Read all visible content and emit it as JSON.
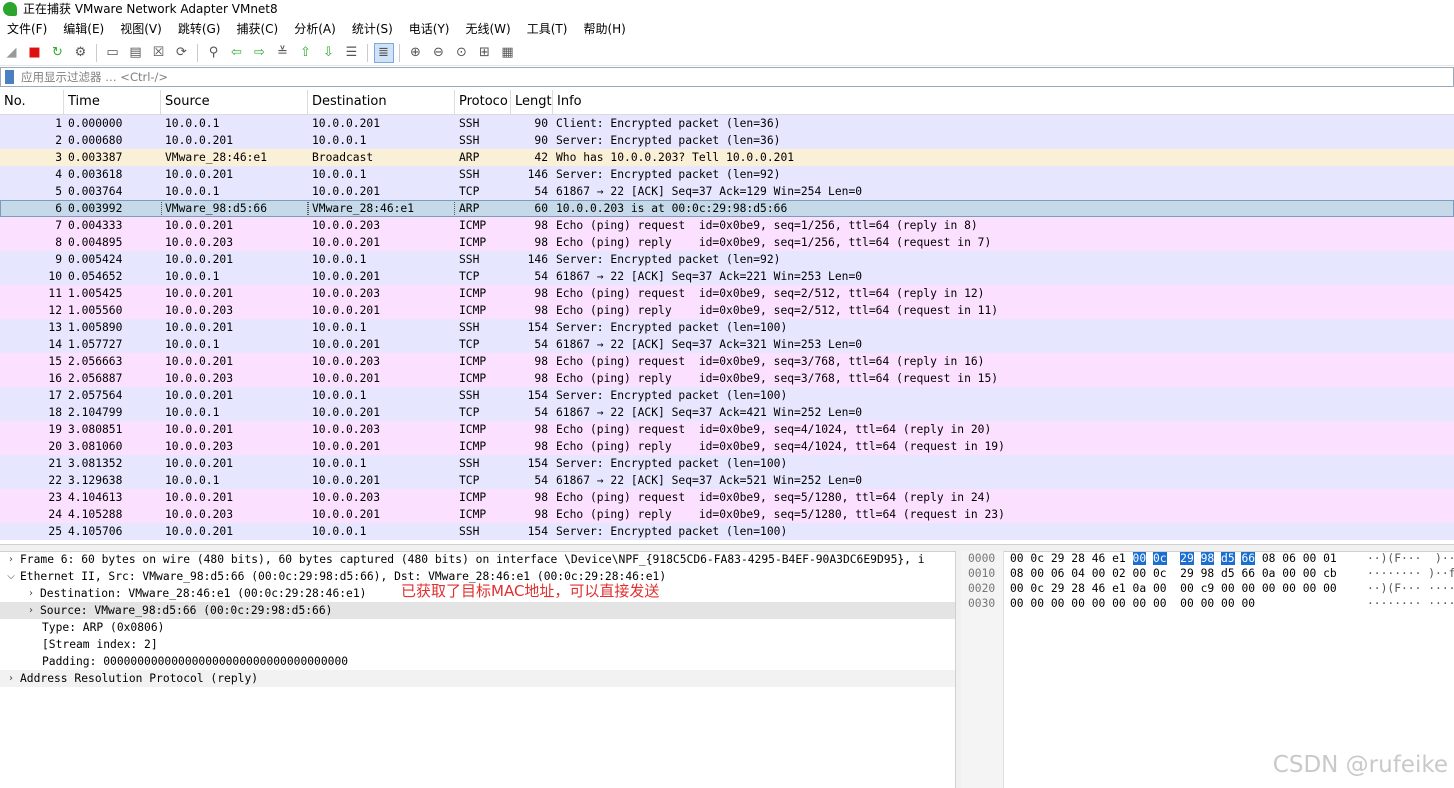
{
  "window": {
    "title": "正在捕获 VMware Network Adapter VMnet8"
  },
  "menu": [
    "文件(F)",
    "编辑(E)",
    "视图(V)",
    "跳转(G)",
    "捕获(C)",
    "分析(A)",
    "统计(S)",
    "电话(Y)",
    "无线(W)",
    "工具(T)",
    "帮助(H)"
  ],
  "toolbar": {
    "icons": [
      "shark-fin-start-icon",
      "stop-capture-icon",
      "restart-capture-icon",
      "capture-options-icon",
      "separator",
      "open-file-icon",
      "save-file-icon",
      "close-file-icon",
      "reload-file-icon",
      "separator",
      "find-packet-icon",
      "go-back-icon",
      "go-forward-icon",
      "go-to-packet-icon",
      "go-first-icon",
      "go-last-icon",
      "auto-scroll-icon",
      "separator",
      "colorize-icon",
      "separator",
      "zoom-in-icon",
      "zoom-out-icon",
      "zoom-normal-icon",
      "resize-columns-icon",
      "layout-icon"
    ]
  },
  "filter": {
    "placeholder": "应用显示过滤器 … <Ctrl-/>",
    "value": ""
  },
  "columns": {
    "no": "No.",
    "time": "Time",
    "source": "Source",
    "destination": "Destination",
    "protocol": "Protoco",
    "length": "Lengt",
    "info": "Info"
  },
  "colors": {
    "ssh": "#e7e6ff",
    "arp": "#faf0d7",
    "icmp": "#fce0ff",
    "tcp": "#e7e6ff",
    "selected": "#c5d9e8"
  },
  "packets": [
    {
      "no": "1",
      "time": "0.000000",
      "src": "10.0.0.1",
      "dst": "10.0.0.201",
      "proto": "SSH",
      "len": "90",
      "info": "Client: Encrypted packet (len=36)"
    },
    {
      "no": "2",
      "time": "0.000680",
      "src": "10.0.0.201",
      "dst": "10.0.0.1",
      "proto": "SSH",
      "len": "90",
      "info": "Server: Encrypted packet (len=36)"
    },
    {
      "no": "3",
      "time": "0.003387",
      "src": "VMware_28:46:e1",
      "dst": "Broadcast",
      "proto": "ARP",
      "len": "42",
      "info": "Who has 10.0.0.203? Tell 10.0.0.201"
    },
    {
      "no": "4",
      "time": "0.003618",
      "src": "10.0.0.201",
      "dst": "10.0.0.1",
      "proto": "SSH",
      "len": "146",
      "info": "Server: Encrypted packet (len=92)"
    },
    {
      "no": "5",
      "time": "0.003764",
      "src": "10.0.0.1",
      "dst": "10.0.0.201",
      "proto": "TCP",
      "len": "54",
      "info": "61867 → 22 [ACK] Seq=37 Ack=129 Win=254 Len=0"
    },
    {
      "no": "6",
      "time": "0.003992",
      "src": "VMware_98:d5:66",
      "dst": "VMware_28:46:e1",
      "proto": "ARP",
      "len": "60",
      "info": "10.0.0.203 is at 00:0c:29:98:d5:66",
      "selected": true
    },
    {
      "no": "7",
      "time": "0.004333",
      "src": "10.0.0.201",
      "dst": "10.0.0.203",
      "proto": "ICMP",
      "len": "98",
      "info": "Echo (ping) request  id=0x0be9, seq=1/256, ttl=64 (reply in 8)"
    },
    {
      "no": "8",
      "time": "0.004895",
      "src": "10.0.0.203",
      "dst": "10.0.0.201",
      "proto": "ICMP",
      "len": "98",
      "info": "Echo (ping) reply    id=0x0be9, seq=1/256, ttl=64 (request in 7)"
    },
    {
      "no": "9",
      "time": "0.005424",
      "src": "10.0.0.201",
      "dst": "10.0.0.1",
      "proto": "SSH",
      "len": "146",
      "info": "Server: Encrypted packet (len=92)"
    },
    {
      "no": "10",
      "time": "0.054652",
      "src": "10.0.0.1",
      "dst": "10.0.0.201",
      "proto": "TCP",
      "len": "54",
      "info": "61867 → 22 [ACK] Seq=37 Ack=221 Win=253 Len=0"
    },
    {
      "no": "11",
      "time": "1.005425",
      "src": "10.0.0.201",
      "dst": "10.0.0.203",
      "proto": "ICMP",
      "len": "98",
      "info": "Echo (ping) request  id=0x0be9, seq=2/512, ttl=64 (reply in 12)"
    },
    {
      "no": "12",
      "time": "1.005560",
      "src": "10.0.0.203",
      "dst": "10.0.0.201",
      "proto": "ICMP",
      "len": "98",
      "info": "Echo (ping) reply    id=0x0be9, seq=2/512, ttl=64 (request in 11)"
    },
    {
      "no": "13",
      "time": "1.005890",
      "src": "10.0.0.201",
      "dst": "10.0.0.1",
      "proto": "SSH",
      "len": "154",
      "info": "Server: Encrypted packet (len=100)"
    },
    {
      "no": "14",
      "time": "1.057727",
      "src": "10.0.0.1",
      "dst": "10.0.0.201",
      "proto": "TCP",
      "len": "54",
      "info": "61867 → 22 [ACK] Seq=37 Ack=321 Win=253 Len=0"
    },
    {
      "no": "15",
      "time": "2.056663",
      "src": "10.0.0.201",
      "dst": "10.0.0.203",
      "proto": "ICMP",
      "len": "98",
      "info": "Echo (ping) request  id=0x0be9, seq=3/768, ttl=64 (reply in 16)"
    },
    {
      "no": "16",
      "time": "2.056887",
      "src": "10.0.0.203",
      "dst": "10.0.0.201",
      "proto": "ICMP",
      "len": "98",
      "info": "Echo (ping) reply    id=0x0be9, seq=3/768, ttl=64 (request in 15)"
    },
    {
      "no": "17",
      "time": "2.057564",
      "src": "10.0.0.201",
      "dst": "10.0.0.1",
      "proto": "SSH",
      "len": "154",
      "info": "Server: Encrypted packet (len=100)"
    },
    {
      "no": "18",
      "time": "2.104799",
      "src": "10.0.0.1",
      "dst": "10.0.0.201",
      "proto": "TCP",
      "len": "54",
      "info": "61867 → 22 [ACK] Seq=37 Ack=421 Win=252 Len=0"
    },
    {
      "no": "19",
      "time": "3.080851",
      "src": "10.0.0.201",
      "dst": "10.0.0.203",
      "proto": "ICMP",
      "len": "98",
      "info": "Echo (ping) request  id=0x0be9, seq=4/1024, ttl=64 (reply in 20)"
    },
    {
      "no": "20",
      "time": "3.081060",
      "src": "10.0.0.203",
      "dst": "10.0.0.201",
      "proto": "ICMP",
      "len": "98",
      "info": "Echo (ping) reply    id=0x0be9, seq=4/1024, ttl=64 (request in 19)"
    },
    {
      "no": "21",
      "time": "3.081352",
      "src": "10.0.0.201",
      "dst": "10.0.0.1",
      "proto": "SSH",
      "len": "154",
      "info": "Server: Encrypted packet (len=100)"
    },
    {
      "no": "22",
      "time": "3.129638",
      "src": "10.0.0.1",
      "dst": "10.0.0.201",
      "proto": "TCP",
      "len": "54",
      "info": "61867 → 22 [ACK] Seq=37 Ack=521 Win=252 Len=0"
    },
    {
      "no": "23",
      "time": "4.104613",
      "src": "10.0.0.201",
      "dst": "10.0.0.203",
      "proto": "ICMP",
      "len": "98",
      "info": "Echo (ping) request  id=0x0be9, seq=5/1280, ttl=64 (reply in 24)"
    },
    {
      "no": "24",
      "time": "4.105288",
      "src": "10.0.0.203",
      "dst": "10.0.0.201",
      "proto": "ICMP",
      "len": "98",
      "info": "Echo (ping) reply    id=0x0be9, seq=5/1280, ttl=64 (request in 23)"
    },
    {
      "no": "25",
      "time": "4.105706",
      "src": "10.0.0.201",
      "dst": "10.0.0.1",
      "proto": "SSH",
      "len": "154",
      "info": "Server: Encrypted packet (len=100)"
    }
  ],
  "details": [
    {
      "text": "Frame 6: 60 bytes on wire (480 bits), 60 bytes captured (480 bits) on interface \\Device\\NPF_{918C5CD6-FA83-4295-B4EF-90A3DC6E9D95}, i",
      "level": 0,
      "expander": "collapsed",
      "style": "normal"
    },
    {
      "text": "Ethernet II, Src: VMware_98:d5:66 (00:0c:29:98:d5:66), Dst: VMware_28:46:e1 (00:0c:29:28:46:e1)",
      "level": 0,
      "expander": "expanded",
      "style": "normal"
    },
    {
      "text": "Destination: VMware_28:46:e1 (00:0c:29:28:46:e1)",
      "level": 1,
      "expander": "collapsed",
      "style": "normal"
    },
    {
      "text": "Source: VMware_98:d5:66 (00:0c:29:98:d5:66)",
      "level": 1,
      "expander": "collapsed",
      "style": "highlight"
    },
    {
      "text": "Type: ARP (0x0806)",
      "level": 1,
      "expander": "none",
      "style": "normal"
    },
    {
      "text": "[Stream index: 2]",
      "level": 1,
      "expander": "none",
      "style": "normal"
    },
    {
      "text": "Padding: 000000000000000000000000000000000000",
      "level": 1,
      "expander": "none",
      "style": "normal"
    },
    {
      "text": "Address Resolution Protocol (reply)",
      "level": 0,
      "expander": "collapsed",
      "style": "grey"
    }
  ],
  "annotation": "已获取了目标MAC地址，可以直接发送",
  "bytes": [
    {
      "offset": "0000",
      "hex": [
        "00",
        "0c",
        "29",
        "28",
        "46",
        "e1",
        "00",
        "0c",
        "29",
        "98",
        "d5",
        "66",
        "08",
        "06",
        "00",
        "01"
      ],
      "ascii": "··)(F···  )··f····",
      "sel": [
        6,
        7,
        8,
        9,
        10,
        11
      ]
    },
    {
      "offset": "0010",
      "hex": [
        "08",
        "00",
        "06",
        "04",
        "00",
        "02",
        "00",
        "0c",
        "29",
        "98",
        "d5",
        "66",
        "0a",
        "00",
        "00",
        "cb"
      ],
      "ascii": "········ )··f····",
      "sel": []
    },
    {
      "offset": "0020",
      "hex": [
        "00",
        "0c",
        "29",
        "28",
        "46",
        "e1",
        "0a",
        "00",
        "00",
        "c9",
        "00",
        "00",
        "00",
        "00",
        "00",
        "00"
      ],
      "ascii": "··)(F··· ········",
      "sel": []
    },
    {
      "offset": "0030",
      "hex": [
        "00",
        "00",
        "00",
        "00",
        "00",
        "00",
        "00",
        "00",
        "00",
        "00",
        "00",
        "00"
      ],
      "ascii": "········ ····",
      "sel": []
    }
  ],
  "watermark": "CSDN @rufeike"
}
